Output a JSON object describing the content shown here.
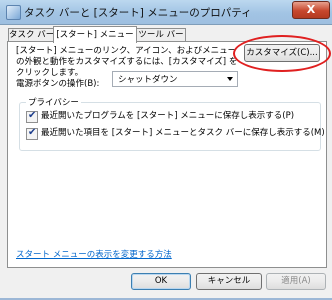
{
  "window": {
    "title": "タスク バーと [スタート] メニューのプロパティ",
    "close_label": "X"
  },
  "tabs": [
    {
      "label": "タスク バー",
      "active": false
    },
    {
      "label": "[スタート] メニュー",
      "active": true
    },
    {
      "label": "ツール バー",
      "active": false
    }
  ],
  "start_menu": {
    "description": "[スタート] メニューのリンク、アイコン、およびメニューの外観と動作をカスタマイズするには、[カスタマイズ] をクリックします。",
    "customize_button": "カスタマイズ(C)...",
    "power_button_label": "電源ボタンの操作(B):",
    "power_button_value": "シャットダウン",
    "privacy": {
      "group_label": "プライバシー",
      "options": [
        {
          "label": "最近開いたプログラムを [スタート] メニューに保存し表示する(P)",
          "checked": true
        },
        {
          "label": "最近開いた項目を [スタート] メニューとタスク バーに保存し表示する(M)",
          "checked": true
        }
      ]
    },
    "help_link": "スタート メニューの表示を変更する方法"
  },
  "buttons": {
    "ok": "OK",
    "cancel": "キャンセル",
    "apply": "適用(A)"
  },
  "colors": {
    "accent": "#0066cc",
    "highlight_circle": "#e02020"
  },
  "icons": {
    "check": "✔"
  }
}
